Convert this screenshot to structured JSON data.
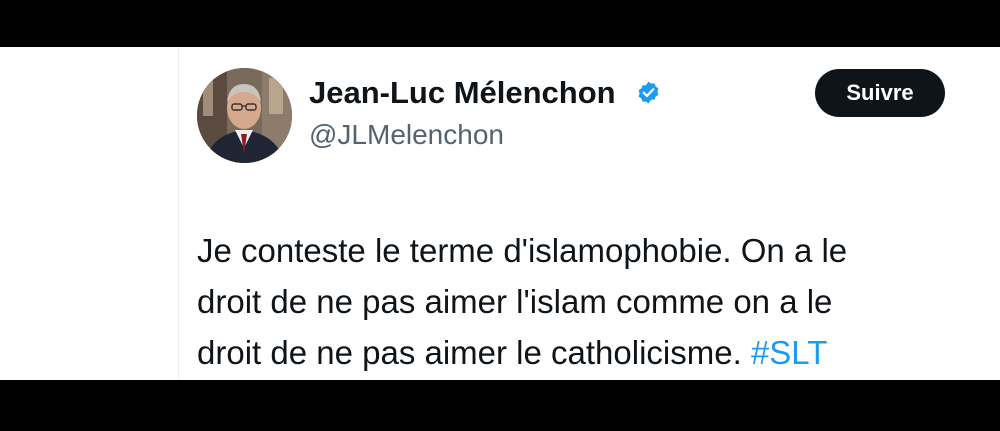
{
  "author": {
    "name": "Jean-Luc Mélenchon",
    "handle": "@JLMelenchon",
    "verified_icon": "verified-badge-icon",
    "verified_color": "#1d9bf0"
  },
  "actions": {
    "follow_label": "Suivre"
  },
  "tweet": {
    "text_lines": [
      "Je conteste le terme d'islamophobie. On a le",
      "droit de ne pas aimer l'islam comme on a le",
      "droit de ne pas aimer le catholicisme."
    ],
    "hashtag": "#SLT"
  },
  "colors": {
    "text": "#0f1419",
    "secondary": "#536471",
    "accent": "#1d9bf0",
    "button_bg": "#0f1419"
  }
}
